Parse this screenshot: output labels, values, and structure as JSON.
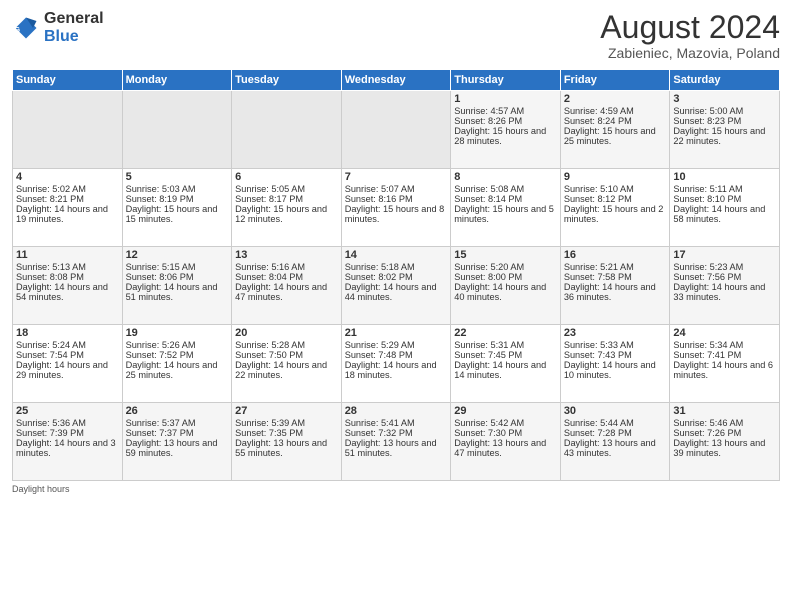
{
  "header": {
    "logo_general": "General",
    "logo_blue": "Blue",
    "month_title": "August 2024",
    "subtitle": "Zabieniec, Mazovia, Poland"
  },
  "weekdays": [
    "Sunday",
    "Monday",
    "Tuesday",
    "Wednesday",
    "Thursday",
    "Friday",
    "Saturday"
  ],
  "weeks": [
    [
      {
        "day": "",
        "empty": true
      },
      {
        "day": "",
        "empty": true
      },
      {
        "day": "",
        "empty": true
      },
      {
        "day": "",
        "empty": true
      },
      {
        "day": "1",
        "sunrise": "4:57 AM",
        "sunset": "8:26 PM",
        "daylight": "15 hours and 28 minutes."
      },
      {
        "day": "2",
        "sunrise": "4:59 AM",
        "sunset": "8:24 PM",
        "daylight": "15 hours and 25 minutes."
      },
      {
        "day": "3",
        "sunrise": "5:00 AM",
        "sunset": "8:23 PM",
        "daylight": "15 hours and 22 minutes."
      }
    ],
    [
      {
        "day": "4",
        "sunrise": "5:02 AM",
        "sunset": "8:21 PM",
        "daylight": "14 hours and 19 minutes."
      },
      {
        "day": "5",
        "sunrise": "5:03 AM",
        "sunset": "8:19 PM",
        "daylight": "15 hours and 15 minutes."
      },
      {
        "day": "6",
        "sunrise": "5:05 AM",
        "sunset": "8:17 PM",
        "daylight": "15 hours and 12 minutes."
      },
      {
        "day": "7",
        "sunrise": "5:07 AM",
        "sunset": "8:16 PM",
        "daylight": "15 hours and 8 minutes."
      },
      {
        "day": "8",
        "sunrise": "5:08 AM",
        "sunset": "8:14 PM",
        "daylight": "15 hours and 5 minutes."
      },
      {
        "day": "9",
        "sunrise": "5:10 AM",
        "sunset": "8:12 PM",
        "daylight": "15 hours and 2 minutes."
      },
      {
        "day": "10",
        "sunrise": "5:11 AM",
        "sunset": "8:10 PM",
        "daylight": "14 hours and 58 minutes."
      }
    ],
    [
      {
        "day": "11",
        "sunrise": "5:13 AM",
        "sunset": "8:08 PM",
        "daylight": "14 hours and 54 minutes."
      },
      {
        "day": "12",
        "sunrise": "5:15 AM",
        "sunset": "8:06 PM",
        "daylight": "14 hours and 51 minutes."
      },
      {
        "day": "13",
        "sunrise": "5:16 AM",
        "sunset": "8:04 PM",
        "daylight": "14 hours and 47 minutes."
      },
      {
        "day": "14",
        "sunrise": "5:18 AM",
        "sunset": "8:02 PM",
        "daylight": "14 hours and 44 minutes."
      },
      {
        "day": "15",
        "sunrise": "5:20 AM",
        "sunset": "8:00 PM",
        "daylight": "14 hours and 40 minutes."
      },
      {
        "day": "16",
        "sunrise": "5:21 AM",
        "sunset": "7:58 PM",
        "daylight": "14 hours and 36 minutes."
      },
      {
        "day": "17",
        "sunrise": "5:23 AM",
        "sunset": "7:56 PM",
        "daylight": "14 hours and 33 minutes."
      }
    ],
    [
      {
        "day": "18",
        "sunrise": "5:24 AM",
        "sunset": "7:54 PM",
        "daylight": "14 hours and 29 minutes."
      },
      {
        "day": "19",
        "sunrise": "5:26 AM",
        "sunset": "7:52 PM",
        "daylight": "14 hours and 25 minutes."
      },
      {
        "day": "20",
        "sunrise": "5:28 AM",
        "sunset": "7:50 PM",
        "daylight": "14 hours and 22 minutes."
      },
      {
        "day": "21",
        "sunrise": "5:29 AM",
        "sunset": "7:48 PM",
        "daylight": "14 hours and 18 minutes."
      },
      {
        "day": "22",
        "sunrise": "5:31 AM",
        "sunset": "7:45 PM",
        "daylight": "14 hours and 14 minutes."
      },
      {
        "day": "23",
        "sunrise": "5:33 AM",
        "sunset": "7:43 PM",
        "daylight": "14 hours and 10 minutes."
      },
      {
        "day": "24",
        "sunrise": "5:34 AM",
        "sunset": "7:41 PM",
        "daylight": "14 hours and 6 minutes."
      }
    ],
    [
      {
        "day": "25",
        "sunrise": "5:36 AM",
        "sunset": "7:39 PM",
        "daylight": "14 hours and 3 minutes."
      },
      {
        "day": "26",
        "sunrise": "5:37 AM",
        "sunset": "7:37 PM",
        "daylight": "13 hours and 59 minutes."
      },
      {
        "day": "27",
        "sunrise": "5:39 AM",
        "sunset": "7:35 PM",
        "daylight": "13 hours and 55 minutes."
      },
      {
        "day": "28",
        "sunrise": "5:41 AM",
        "sunset": "7:32 PM",
        "daylight": "13 hours and 51 minutes."
      },
      {
        "day": "29",
        "sunrise": "5:42 AM",
        "sunset": "7:30 PM",
        "daylight": "13 hours and 47 minutes."
      },
      {
        "day": "30",
        "sunrise": "5:44 AM",
        "sunset": "7:28 PM",
        "daylight": "13 hours and 43 minutes."
      },
      {
        "day": "31",
        "sunrise": "5:46 AM",
        "sunset": "7:26 PM",
        "daylight": "13 hours and 39 minutes."
      }
    ]
  ],
  "footer_label": "Daylight hours"
}
